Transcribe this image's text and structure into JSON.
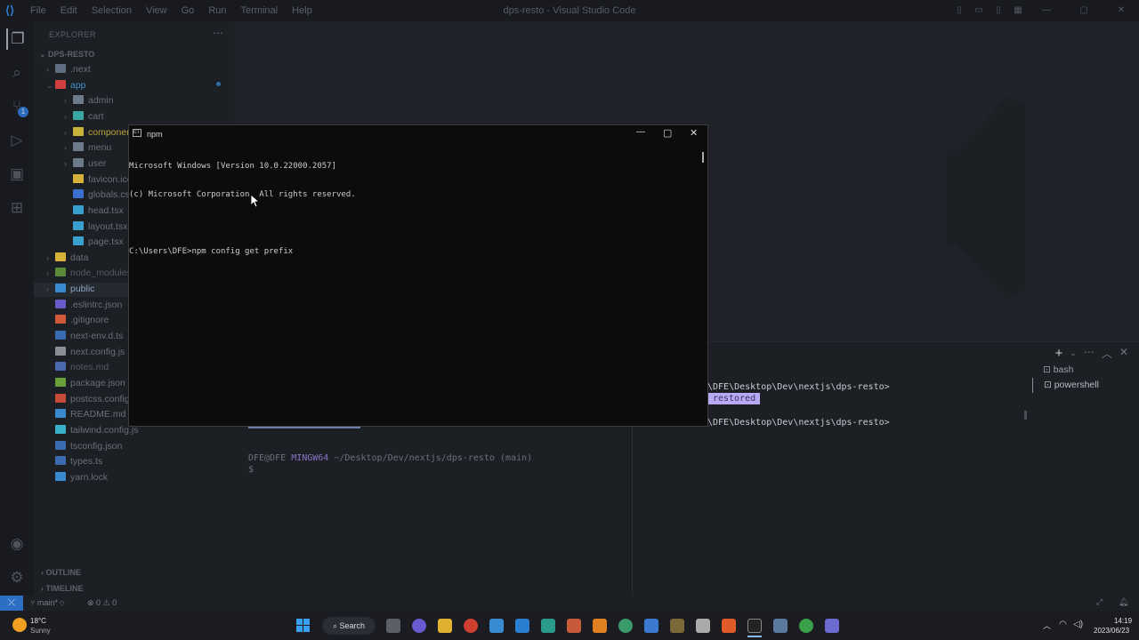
{
  "window": {
    "title": "dps-resto - Visual Studio Code"
  },
  "menu": [
    "File",
    "Edit",
    "Selection",
    "View",
    "Go",
    "Run",
    "Terminal",
    "Help"
  ],
  "sidebar": {
    "header": "EXPLORER",
    "project": "DPS-RESTO",
    "items": [
      {
        "label": ".next",
        "indent": 1,
        "chevron": "›",
        "color": "#6a707a",
        "icon": "#5f6e80"
      },
      {
        "label": "app",
        "indent": 1,
        "chevron": "⌄",
        "color": "#3f8fd0",
        "icon": "#d04040"
      },
      {
        "label": "admin",
        "indent": 2,
        "chevron": "›",
        "color": "#6a707a",
        "icon": "#6c7a8a"
      },
      {
        "label": "cart",
        "indent": 2,
        "chevron": "›",
        "color": "#6a707a",
        "icon": "#3aa8a0"
      },
      {
        "label": "components",
        "indent": 2,
        "chevron": "›",
        "color": "#b7a23a",
        "icon": "#c8b43a"
      },
      {
        "label": "menu",
        "indent": 2,
        "chevron": "›",
        "color": "#6a707a",
        "icon": "#6c7a8a"
      },
      {
        "label": "user",
        "indent": 2,
        "chevron": "›",
        "color": "#6a707a",
        "icon": "#6c7a8a"
      },
      {
        "label": "favicon.ico",
        "indent": 2,
        "chevron": "",
        "color": "#6a707a",
        "icon": "#d6b23a"
      },
      {
        "label": "globals.css",
        "indent": 2,
        "chevron": "",
        "color": "#6a707a",
        "icon": "#3b6fd0"
      },
      {
        "label": "head.tsx",
        "indent": 2,
        "chevron": "",
        "color": "#6a707a",
        "icon": "#3aa0d0"
      },
      {
        "label": "layout.tsx",
        "indent": 2,
        "chevron": "",
        "color": "#6a707a",
        "icon": "#3aa0d0"
      },
      {
        "label": "page.tsx",
        "indent": 2,
        "chevron": "",
        "color": "#6a707a",
        "icon": "#3aa0d0"
      },
      {
        "label": "data",
        "indent": 1,
        "chevron": "›",
        "color": "#6a707a",
        "icon": "#d6b23a"
      },
      {
        "label": "node_modules",
        "indent": 1,
        "chevron": "›",
        "color": "#555a62",
        "icon": "#5a8a3a"
      },
      {
        "label": "public",
        "indent": 1,
        "chevron": "›",
        "color": "#8aa0c0",
        "icon": "#3a8ad0"
      },
      {
        "label": ".eslintrc.json",
        "indent": 1,
        "chevron": "",
        "color": "#6a707a",
        "icon": "#6a5ac8"
      },
      {
        "label": ".gitignore",
        "indent": 1,
        "chevron": "",
        "color": "#6a707a",
        "icon": "#d05a3a"
      },
      {
        "label": "next-env.d.ts",
        "indent": 1,
        "chevron": "",
        "color": "#6a707a",
        "icon": "#3a6ab0"
      },
      {
        "label": "next.config.js",
        "indent": 1,
        "chevron": "",
        "color": "#6a707a",
        "icon": "#8a8f97"
      },
      {
        "label": "notes.md",
        "indent": 1,
        "chevron": "",
        "color": "#555a62",
        "icon": "#4a6ab0"
      },
      {
        "label": "package.json",
        "indent": 1,
        "chevron": "",
        "color": "#6a707a",
        "icon": "#6aa03a"
      },
      {
        "label": "postcss.config.js",
        "indent": 1,
        "chevron": "",
        "color": "#6a707a",
        "icon": "#c84a3a"
      },
      {
        "label": "README.md",
        "indent": 1,
        "chevron": "",
        "color": "#6a707a",
        "icon": "#3a8ad0"
      },
      {
        "label": "tailwind.config.js",
        "indent": 1,
        "chevron": "",
        "color": "#6a707a",
        "icon": "#3ab0c8"
      },
      {
        "label": "tsconfig.json",
        "indent": 1,
        "chevron": "",
        "color": "#6a707a",
        "icon": "#3a6ab0"
      },
      {
        "label": "types.ts",
        "indent": 1,
        "chevron": "",
        "color": "#6a707a",
        "icon": "#3a6ab0"
      },
      {
        "label": "yarn.lock",
        "indent": 1,
        "chevron": "",
        "color": "#6a707a",
        "icon": "#3a8ad0"
      }
    ],
    "outline": "OUTLINE",
    "timeline": "TIMELINE"
  },
  "terminal": {
    "line1": "\\DFE\\Desktop\\Dev\\nextjs\\dps-resto>",
    "restored": "restored",
    "line2": "\\DFE\\Desktop\\Dev\\nextjs\\dps-resto>",
    "bash_prompt_user": "DFE@DFE",
    "bash_prompt_host": "MINGW64",
    "bash_prompt_path": "~/Desktop/Dev/nextjs/dps-resto",
    "bash_prompt_branch": "(main)",
    "bash_cursor": "$",
    "list": [
      "bash",
      "powershell"
    ]
  },
  "cmd": {
    "title": "npm",
    "lines": [
      "Microsoft Windows [Version 10.0.22000.2057]",
      "(c) Microsoft Corporation. All rights reserved.",
      "",
      "C:\\Users\\DFE>npm config get prefix"
    ]
  },
  "status": {
    "branch": "main*",
    "problems": "⊗ 0 ⚠ 0"
  },
  "taskbar": {
    "weather_temp": "18°C",
    "weather_desc": "Sunny",
    "search": "Search",
    "time": "14:19",
    "date": "2023/06/23"
  },
  "colors": {
    "accent": "#2d6fc4",
    "restored_bg": "#b8a9f2"
  }
}
